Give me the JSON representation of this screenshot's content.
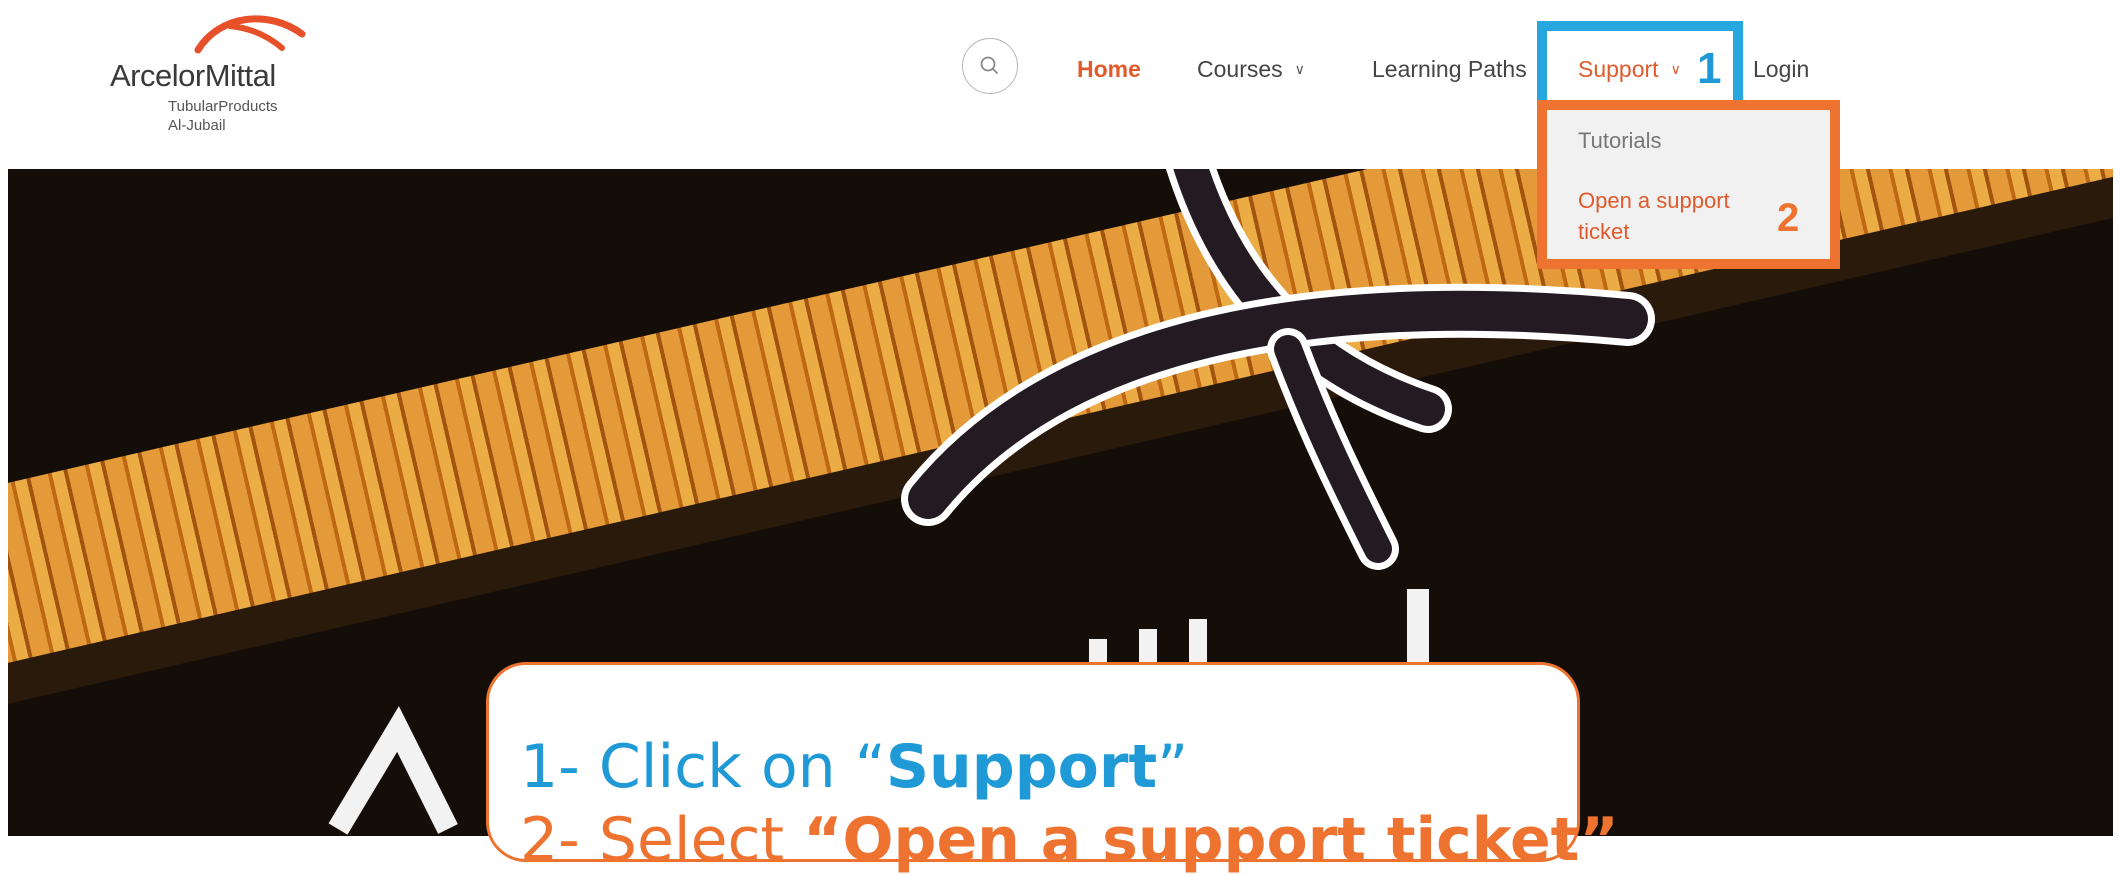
{
  "brand": {
    "name": "ArcelorMittal",
    "sub1": "TubularProducts",
    "sub2": "Al-Jubail",
    "color": "#e05a2b"
  },
  "nav": {
    "home": "Home",
    "courses": "Courses",
    "learning_paths": "Learning Paths",
    "support": "Support",
    "login": "Login"
  },
  "support_menu": {
    "items": [
      "Tutorials",
      "Open a support ticket"
    ]
  },
  "annotations": {
    "step1": "1",
    "step2": "2",
    "step1_color": "#27a7e0",
    "step2_color": "#ee7330"
  },
  "caption": {
    "line1_prefix": "1- Click on ",
    "line1_open": "“",
    "line1_bold": "Support",
    "line1_close": "”",
    "line2_prefix": "2- Select ",
    "line2_bold": "“Open a support ticket”"
  }
}
